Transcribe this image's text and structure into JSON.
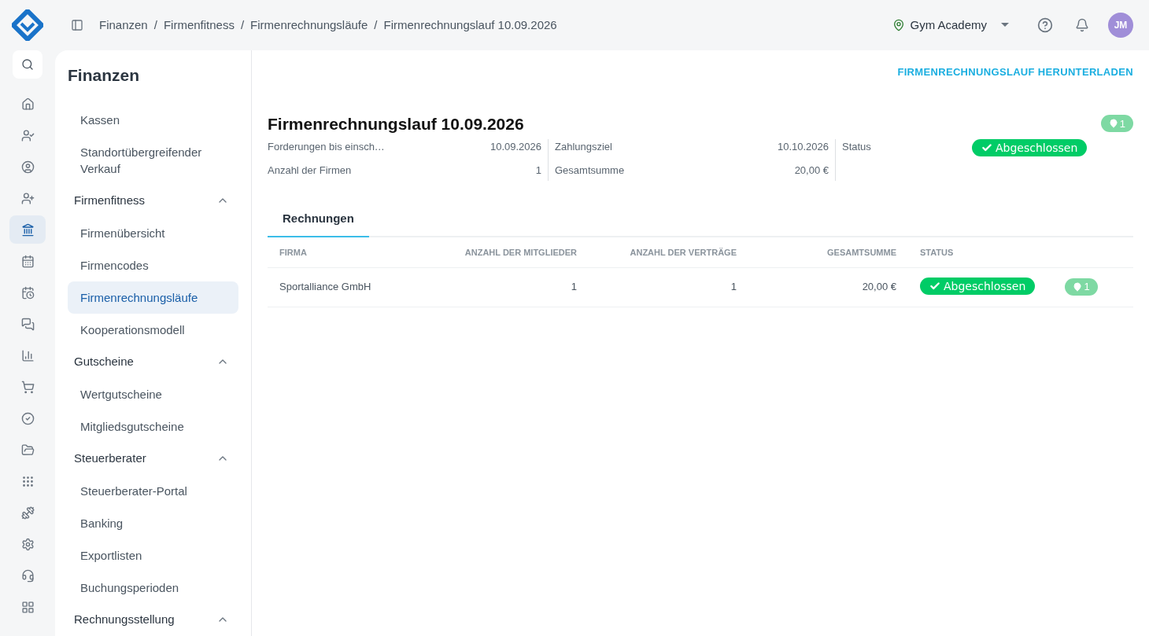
{
  "breadcrumb": {
    "separator": "/",
    "items": [
      "Finanzen",
      "Firmenfitness",
      "Firmenrechnungsläufe",
      "Firmenrechnungslauf 10.09.2026"
    ]
  },
  "location": "Gym Academy",
  "user": {
    "initials": "JM"
  },
  "rail": [
    {
      "selected": false
    },
    {
      "selected": false
    },
    {
      "selected": false
    },
    {
      "selected": false
    },
    {
      "selected": true
    },
    {
      "selected": false
    },
    {
      "selected": false
    },
    {
      "selected": false
    },
    {
      "selected": false
    },
    {
      "selected": false
    },
    {
      "selected": false
    },
    {
      "selected": false
    },
    {
      "selected": false
    },
    {
      "selected": false
    },
    {
      "selected": false
    },
    {
      "selected": false
    },
    {
      "selected": false
    }
  ],
  "sidebar": {
    "title": "Finanzen",
    "items": [
      {
        "kind": "link",
        "label": "Kassen",
        "selected": false
      },
      {
        "kind": "link",
        "label": "Standortübergreifender Verkauf",
        "selected": false
      },
      {
        "kind": "group",
        "label": "Firmenfitness",
        "expanded": true,
        "children": [
          {
            "label": "Firmenübersicht",
            "selected": false
          },
          {
            "label": "Firmencodes",
            "selected": false
          },
          {
            "label": "Firmenrechnungsläufe",
            "selected": true
          },
          {
            "label": "Kooperationsmodell",
            "selected": false
          }
        ]
      },
      {
        "kind": "group",
        "label": "Gutscheine",
        "expanded": true,
        "children": [
          {
            "label": "Wertgutscheine",
            "selected": false
          },
          {
            "label": "Mitgliedsgutscheine",
            "selected": false
          }
        ]
      },
      {
        "kind": "group",
        "label": "Steuerberater",
        "expanded": true,
        "children": [
          {
            "label": "Steuerberater-Portal",
            "selected": false
          },
          {
            "label": "Banking",
            "selected": false
          },
          {
            "label": "Exportlisten",
            "selected": false
          },
          {
            "label": "Buchungsperioden",
            "selected": false
          }
        ]
      },
      {
        "kind": "group",
        "label": "Rechnungsstellung",
        "expanded": true
      }
    ]
  },
  "download_link": "FIRMENRECHNUNGSLAUF HERUNTERLADEN",
  "title": "Firmenrechnungslauf 10.09.2026",
  "location_badge": "1",
  "details": [
    [
      {
        "label": "Forderungen bis einsch…",
        "value": "10.09.2026"
      },
      {
        "label": "Anzahl der Firmen",
        "value": "1"
      }
    ],
    [
      {
        "label": "Zahlungsziel",
        "value": "10.10.2026"
      },
      {
        "label": "Gesamtsumme",
        "value": "20,00 €"
      }
    ]
  ],
  "status": {
    "label": "Status",
    "value": "Abgeschlossen"
  },
  "tabs": [
    {
      "label": "Rechnungen",
      "selected": true
    }
  ],
  "table": {
    "columns": [
      "FIRMA",
      "ANZAHL DER MITGLIEDER",
      "ANZAHL DER VERTRÄGE",
      "GESAMTSUMME",
      "STATUS"
    ],
    "rows": [
      {
        "firma": "Sportalliance GmbH",
        "mitglieder": "1",
        "vertraege": "1",
        "summe": "20,00 €",
        "status": "Abgeschlossen",
        "badge": "1"
      }
    ]
  }
}
